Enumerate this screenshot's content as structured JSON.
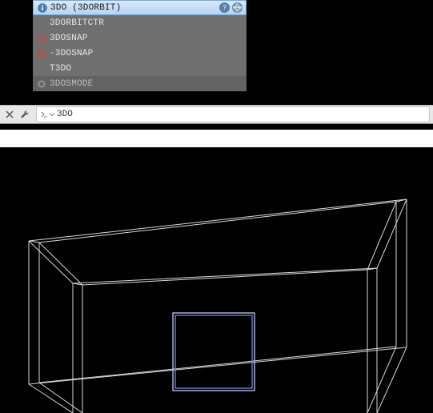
{
  "autocomplete": {
    "items": [
      {
        "label": "3DO (3DORBIT)",
        "selected": true,
        "icon": "info"
      },
      {
        "label": "3DORBITCTR",
        "selected": false,
        "icon": null
      },
      {
        "label": "3DOSNAP",
        "selected": false,
        "icon": "snap"
      },
      {
        "label": "-3DOSNAP",
        "selected": false,
        "icon": "snap"
      },
      {
        "label": "T3DO",
        "selected": false,
        "icon": null
      },
      {
        "label": "3DOSMODE",
        "selected": false,
        "icon": "gear",
        "dim": true
      }
    ]
  },
  "commandLine": {
    "value": "3DO"
  },
  "viewport": {
    "description": "3D wireframe box with selected rectangle"
  }
}
